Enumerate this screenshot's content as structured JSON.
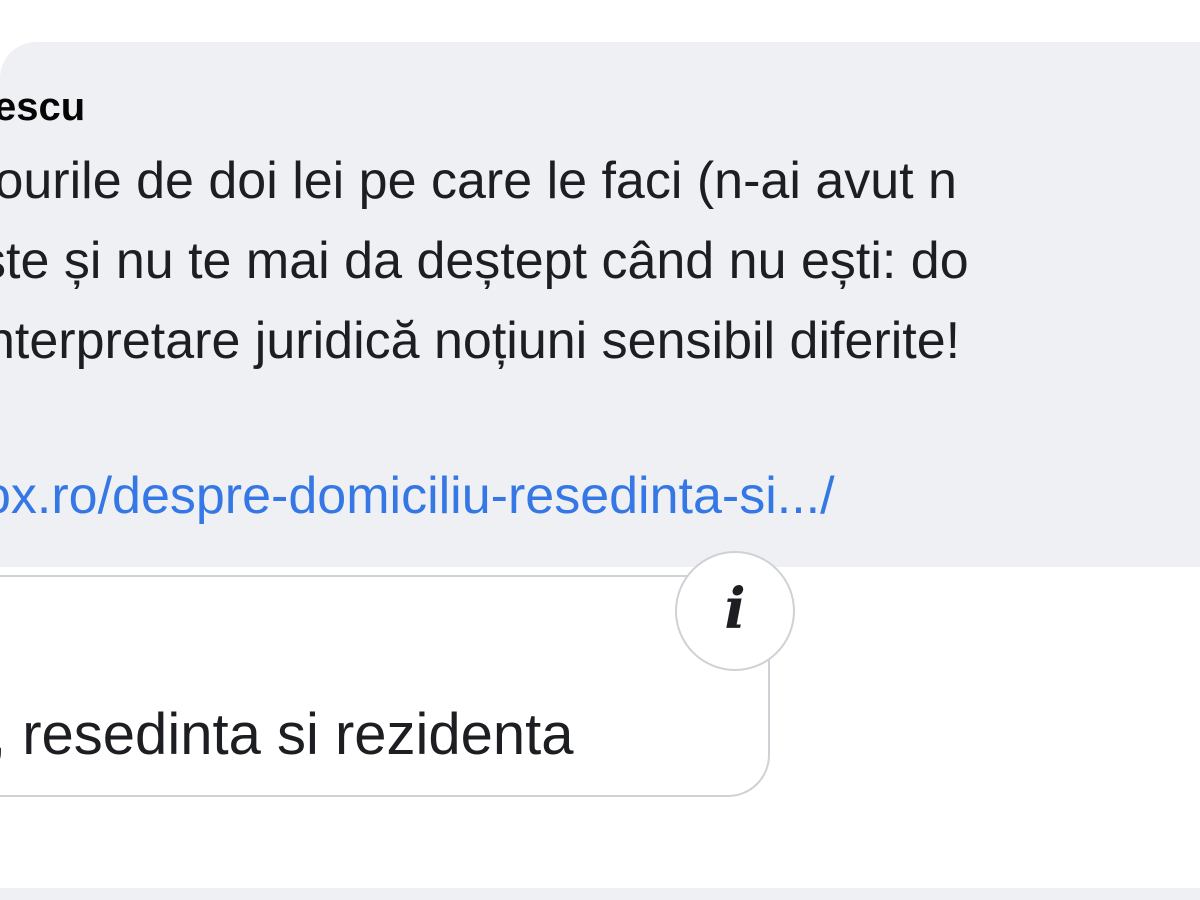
{
  "comment": {
    "author_fragment": "escu",
    "lines": [
      "tourile de doi lei pe care le faci (n-ai avut n",
      "ște și nu te mai da deștept când nu ești: do",
      "nterpretare juridică noțiuni sensibil diferite! "
    ],
    "link_text": "ox.ro/despre-domiciliu-resedinta-si.../"
  },
  "link_preview": {
    "title_fragment": ", resedinta si rezidenta",
    "info_glyph": "i",
    "info_icon": "info-icon"
  },
  "colors": {
    "bubble_background": "#eff0f4",
    "link": "#3578e5",
    "text": "#1c1e21",
    "card_border": "#d0d1d6"
  }
}
